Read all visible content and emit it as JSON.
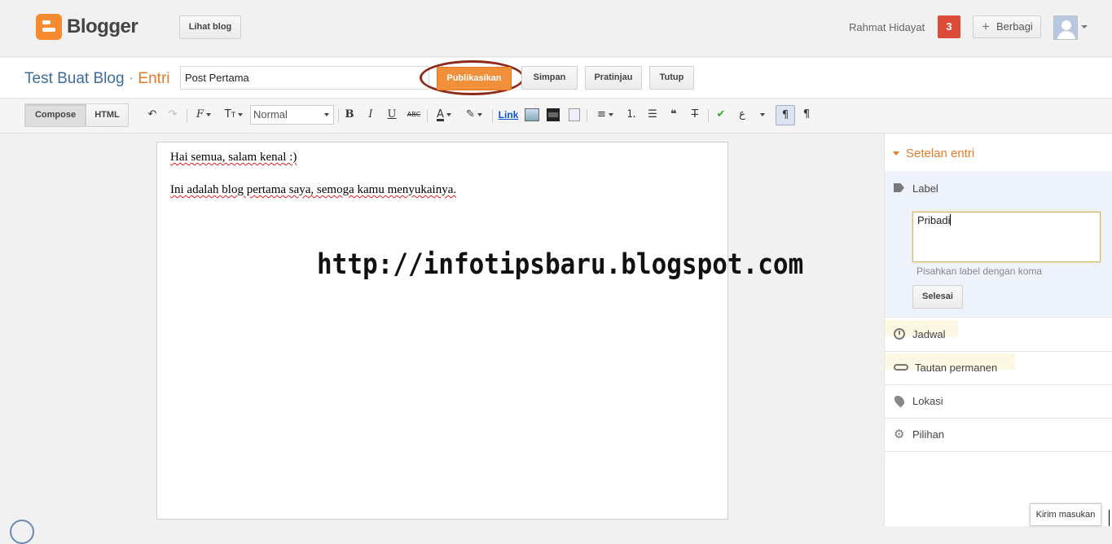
{
  "header": {
    "logo_text": "Blogger",
    "view_blog_label": "Lihat blog",
    "user_name": "Rahmat Hidayat",
    "notification_count": "3",
    "share_label": "Berbagi"
  },
  "titlebar": {
    "blog_name": "Test Buat Blog",
    "separator": "·",
    "section": "Entri",
    "post_title_value": "Post Pertama",
    "publish_label": "Publikasikan",
    "save_label": "Simpan",
    "preview_label": "Pratinjau",
    "close_label": "Tutup"
  },
  "toolbar": {
    "compose_label": "Compose",
    "html_label": "HTML",
    "format_selected": "Normal",
    "link_label": "Link"
  },
  "editor": {
    "paragraphs": [
      "Hai semua, salam kenal :)",
      "Ini adalah blog pertama saya, semoga kamu menyukainya."
    ],
    "watermark": "http://infotipsbaru.blogspot.com"
  },
  "sidebar": {
    "heading": "Setelan entri",
    "label_section": {
      "title": "Label",
      "input_value": "Pribadi",
      "hint": "Pisahkan label dengan koma",
      "done_label": "Selesai"
    },
    "items": [
      {
        "label": "Jadwal",
        "icon": "clock-icon"
      },
      {
        "label": "Tautan permanen",
        "icon": "link-icon"
      },
      {
        "label": "Lokasi",
        "icon": "location-pin-icon"
      },
      {
        "label": "Pilihan",
        "icon": "gear-icon"
      }
    ]
  },
  "feedback_label": "Kirim masukan",
  "colors": {
    "brand_orange": "#f58b2e",
    "publish_button": "#f18f3b",
    "blog_title_blue": "#3d6c9b",
    "notification_red": "#dd4b39",
    "highlight_ring": "#8e2a1a"
  }
}
